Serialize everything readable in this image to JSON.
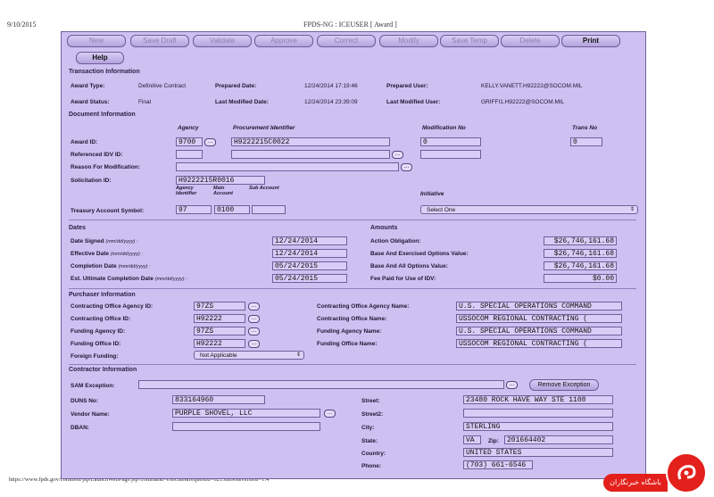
{
  "browser": {
    "date": "9/10/2015",
    "window_title": "FPDS-NG : ICEUSER [ Award ]",
    "status_url": "https://www.fpds.gov/common/jsp/LaunchWebPage.jsp?command=execute&requestid=62158890&version=1.4"
  },
  "toolbar": {
    "new": "New",
    "save_draft": "Save Draft",
    "validate": "Validate",
    "approve": "Approve",
    "correct": "Correct",
    "modify": "Modify",
    "save_temp": "Save Temp",
    "delete": "Delete",
    "print": "Print",
    "help": "Help"
  },
  "transaction": {
    "title": "Transaction Information",
    "award_type_label": "Award Type:",
    "award_type": "Definitive Contract",
    "prepared_date_label": "Prepared Date:",
    "prepared_date": "12/24/2014 17:19:46",
    "prepared_user_label": "Prepared User:",
    "prepared_user": "KELLY.VANETT.H92222@SOCOM.MIL",
    "award_status_label": "Award Status:",
    "award_status": "Final",
    "last_modified_date_label": "Last Modified Date:",
    "last_modified_date": "12/24/2014 23:39:09",
    "last_modified_user_label": "Last Modified User:",
    "last_modified_user": "GRIFFI1.H92222@SOCOM.MIL"
  },
  "document": {
    "title": "Document Information",
    "col_agency": "Agency",
    "col_procurement": "Procurement Identifier",
    "col_modification": "Modification No",
    "col_trans": "Trans No",
    "award_id_label": "Award ID:",
    "agency": "9700",
    "procurement_id": "H9222215C0022",
    "modification_no": "0",
    "trans_no": "0",
    "ref_idv_label": "Referenced IDV ID:",
    "reason_label": "Reason For Modification:",
    "solicitation_label": "Solicitation ID:",
    "solicitation_id": "H9222215R0016",
    "tas_sub_agency": "Agency Identifier",
    "tas_sub_main": "Main Account",
    "tas_sub_sub": "Sub Account",
    "initiative_label": "Initiative",
    "tas_label": "Treasury Account Symbol:",
    "tas_agency": "97",
    "tas_main": "0100",
    "initiative_value": "Select One"
  },
  "dates": {
    "title": "Dates",
    "signed_label": "Date Signed",
    "signed_fmt": "(mm/dd/yyyy) :",
    "signed": "12/24/2014",
    "effective_label": "Effective Date",
    "effective_fmt": "(mm/dd/yyyy) :",
    "effective": "12/24/2014",
    "completion_label": "Completion Date",
    "completion_fmt": "(mm/dd/yyyy) :",
    "completion": "05/24/2015",
    "ult_label": "Est. Ultimate Completion Date",
    "ult_fmt": "(mm/dd/yyyy) :",
    "ult": "05/24/2015"
  },
  "amounts": {
    "title": "Amounts",
    "action_label": "Action Obligation:",
    "action": "$26,746,161.68",
    "exercised_label": "Base And Exercised Options Value:",
    "exercised": "$26,746,161.68",
    "all_label": "Base And All Options Value:",
    "all": "$26,746,161.68",
    "fee_label": "Fee Paid for Use of IDV:",
    "fee": "$0.00"
  },
  "purchaser": {
    "title": "Purchaser Information",
    "co_agency_id_label": "Contracting Office Agency ID:",
    "co_agency_id": "97ZS",
    "co_id_label": "Contracting Office ID:",
    "co_id": "H92222",
    "f_agency_id_label": "Funding Agency ID:",
    "f_agency_id": "97ZS",
    "f_office_id_label": "Funding Office ID:",
    "f_office_id": "H92222",
    "foreign_label": "Foreign Funding:",
    "foreign": "Not Applicable",
    "co_agency_name_label": "Contracting Office Agency Name:",
    "co_agency_name": "U.S. SPECIAL OPERATIONS COMMAND",
    "co_name_label": "Contracting Office Name:",
    "co_name": "USSOCOM REGIONAL CONTRACTING (",
    "f_agency_name_label": "Funding Agency Name:",
    "f_agency_name": "U.S. SPECIAL OPERATIONS COMMAND",
    "f_office_name_label": "Funding Office Name:",
    "f_office_name": "USSOCOM REGIONAL CONTRACTING ("
  },
  "contractor": {
    "title": "Contractor Information",
    "sam_label": "SAM Exception:",
    "remove_exception": "Remove Exception",
    "duns_label": "DUNS No:",
    "duns": "833164960",
    "vendor_label": "Vendor Name:",
    "vendor": "PURPLE SHOVEL, LLC",
    "dban_label": "DBAN:",
    "street_label": "Street:",
    "street": "23480 ROCK HAVE WAY STE 1108",
    "street2_label": "Street2:",
    "city_label": "City:",
    "city": "STERLING",
    "state_label": "State:",
    "state": "VA",
    "zip_label": "Zip:",
    "zip": "201664402",
    "country_label": "Country:",
    "country": "UNITED STATES",
    "phone_label": "Phone:",
    "phone": "(703) 661-6546"
  },
  "watermark": {
    "text": "باشگاه خبرنگاران"
  },
  "colors": {
    "panel": "#cfc0f2",
    "field": "#d9ccf7",
    "border": "#6f5f9a",
    "logo_red": "#e3201b"
  }
}
